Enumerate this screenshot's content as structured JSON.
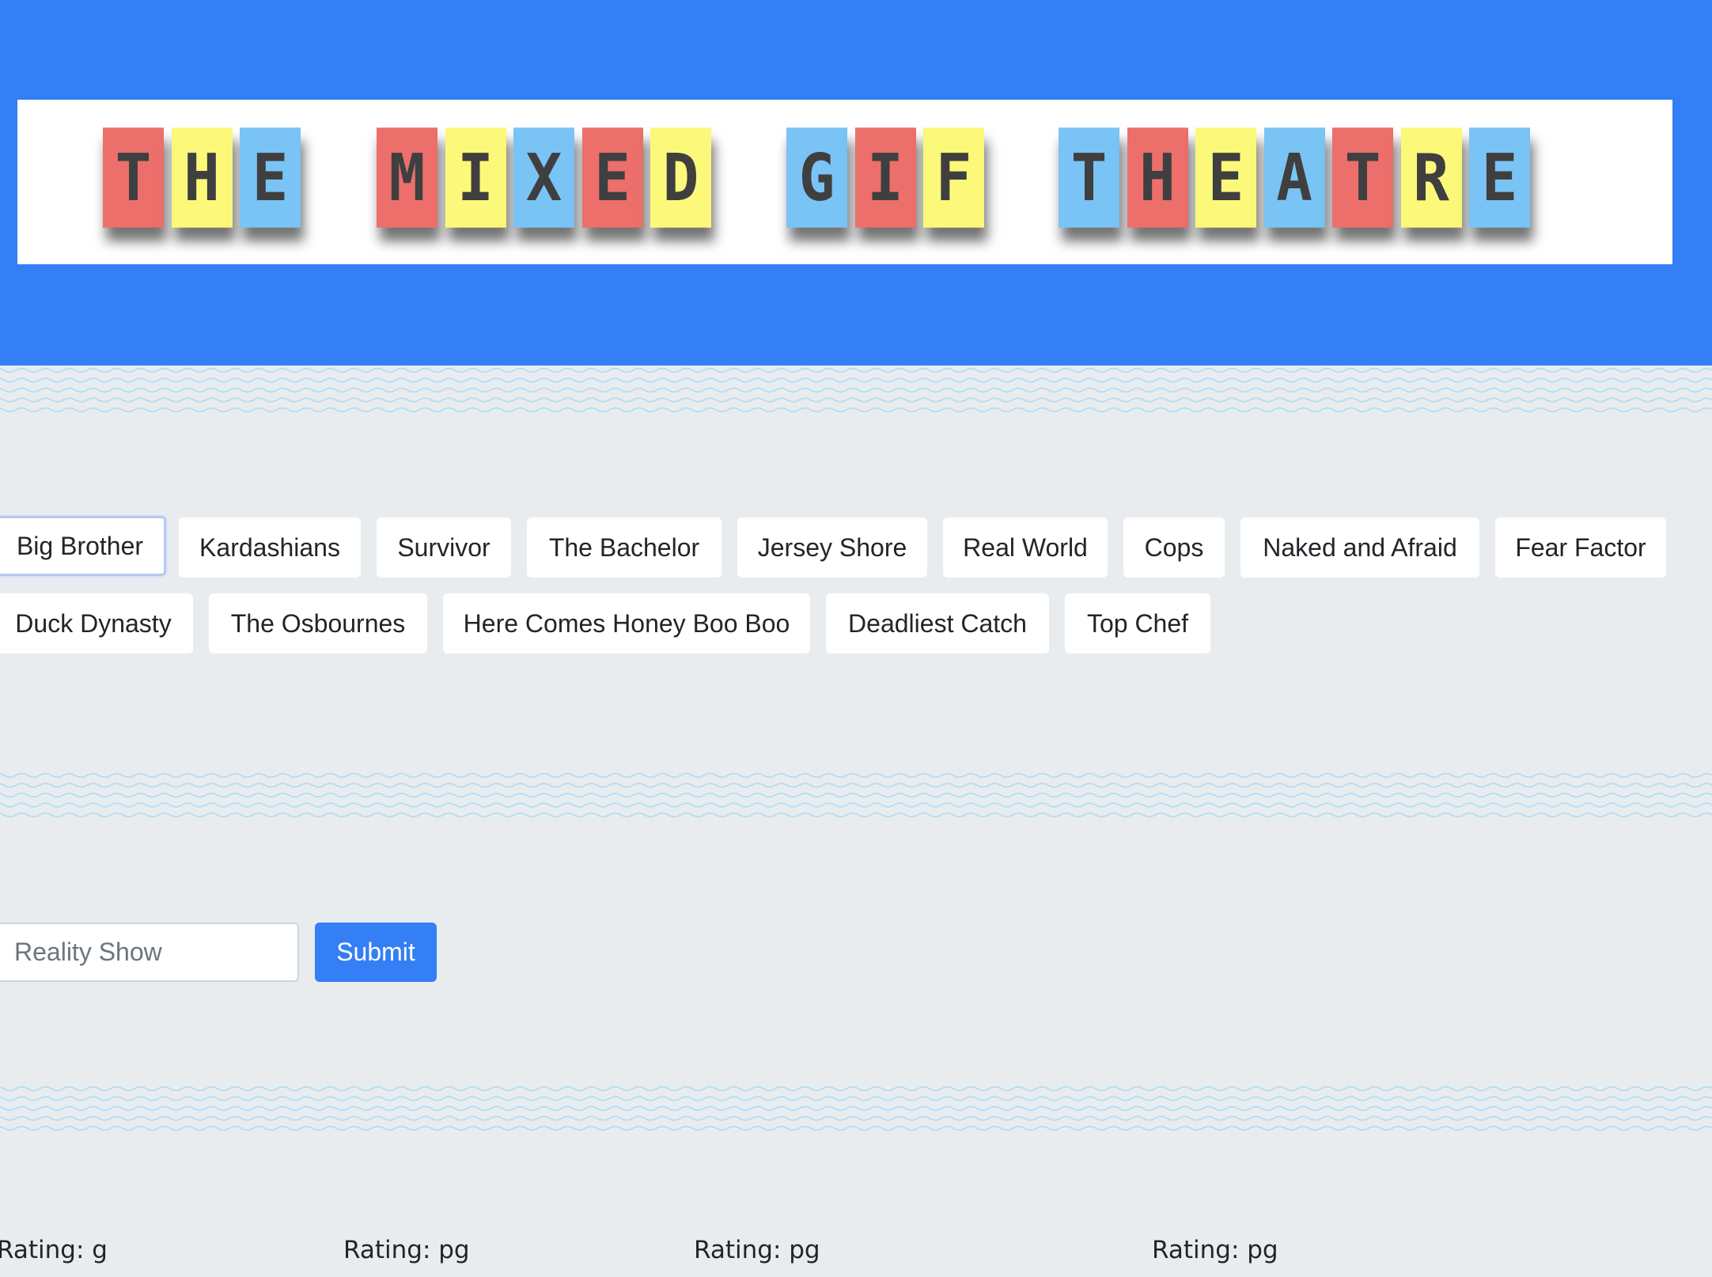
{
  "header": {
    "banner_title": "THE MIXED GIF THEATRE",
    "banner_colors": [
      "#ec6f6b",
      "#fcf97a",
      "#7ac3f5"
    ],
    "background_color": "#347ef6"
  },
  "shows": [
    "Big Brother",
    "Kardashians",
    "Survivor",
    "The Bachelor",
    "Jersey Shore",
    "Real World",
    "Cops",
    "Naked and Afraid",
    "Fear Factor",
    "Duck Dynasty",
    "The Osbournes",
    "Here Comes Honey Boo Boo",
    "Deadliest Catch",
    "Top Chef"
  ],
  "form": {
    "input_placeholder": "Reality Show",
    "submit_label": "Submit"
  },
  "ratings": [
    "Rating: g",
    "Rating: pg",
    "Rating: pg",
    "Rating: pg"
  ],
  "colors": {
    "primary": "#347ef6",
    "page_background": "#e9ecef",
    "wave": "#b6def4"
  }
}
